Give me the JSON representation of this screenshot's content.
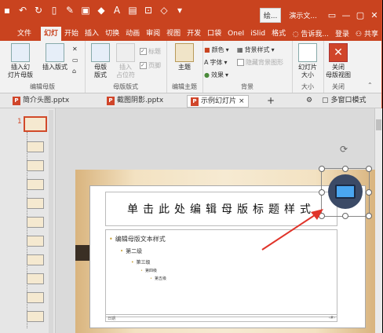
{
  "titlebar": {
    "window_chip": "绘...",
    "doc_title": "演示文..."
  },
  "tabs": [
    "文件",
    "幻灯",
    "开始",
    "插入",
    "切换",
    "动画",
    "审阅",
    "视图",
    "开发",
    "口袋",
    "OneI",
    "iSlid",
    "格式"
  ],
  "tabs_right": {
    "tell_me": "告诉我...",
    "login": "登录",
    "share": "共享"
  },
  "ribbon": {
    "insert_master": "插入幻\n灯片母版",
    "insert_layout": "插入版式",
    "group_edit_master": "编辑母版",
    "master_layout": "母版\n版式",
    "insert_placeholder": "插入\n占位符",
    "chk_title": "标题",
    "chk_footer": "页脚",
    "group_master_layout": "母版版式",
    "theme": "主题",
    "group_edit_theme": "编辑主题",
    "colors": "颜色",
    "fonts": "字体",
    "effects": "效果",
    "bg_styles": "背景样式",
    "hide_bg": "隐藏背景图形",
    "group_background": "背景",
    "slide_size": "幻灯片\n大小",
    "group_size": "大小",
    "close_master": "关闭\n母版视图",
    "group_close": "关闭"
  },
  "doc_tabs": [
    "简介头图.pptx",
    "截图阴影.pptx",
    "示例幻灯片"
  ],
  "doc_tabs_right": "多窗口模式",
  "thumbs": {
    "slide_number": "1"
  },
  "slide": {
    "title": "单击此处编辑母版标题样式",
    "levels": [
      "编辑母版文本样式",
      "第二级",
      "第三级",
      "第四级",
      "第五级"
    ],
    "footer_left": "日期",
    "footer_right": "‹#›"
  },
  "colors": {
    "accent": "#c9431f",
    "arrow": "#e0342a",
    "icon_bg": "#3b4a66",
    "laptop": "#4aa6f0"
  }
}
